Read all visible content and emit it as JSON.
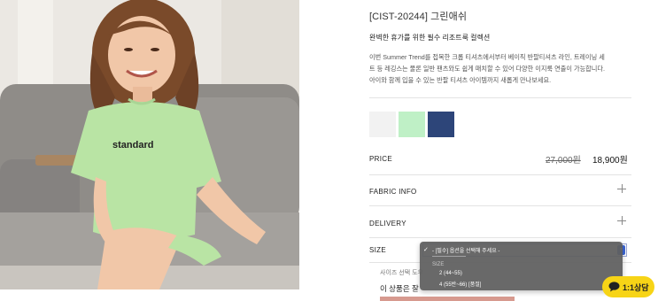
{
  "product": {
    "title": "[CIST-20244] 그린애쉬",
    "subtitle": "완벽한 휴가를 위한 필수 리조트룩 컬렉션",
    "description_lines": [
      "이번 Summer Trend를 접목한 크롭 티셔츠에서부터 베이직 반팔티셔츠 라인, 트레이닝 세",
      "트 등 레깅스는 물론 일반 팬츠와도 쉽게 매치할 수 있어 다양한 이지룩 연출이 가능합니다.",
      "아이와 함께 입을 수 있는 반팔 티셔츠 아이템까지 새롭게 만나보세요."
    ],
    "shirt_print": "standard"
  },
  "swatches": [
    {
      "name": "white",
      "color": "#f2f2f2"
    },
    {
      "name": "mint-green",
      "color": "#bff0c6"
    },
    {
      "name": "navy",
      "color": "#2d4579"
    }
  ],
  "price": {
    "label": "PRICE",
    "original": "27,000원",
    "sale": "18,900원"
  },
  "sections": {
    "fabric_info": "FABRIC INFO",
    "delivery": "DELIVERY"
  },
  "size": {
    "label": "SIZE",
    "dropdown": {
      "selected": "- [필수] 옵션을 선택해 주세요 -",
      "divider": "-------------------",
      "group_label": "SIZE",
      "options": [
        "2 (44~55)",
        "4 (55반~66) [품절]"
      ]
    }
  },
  "helper": {
    "line1": "사이즈 선택 도우",
    "line2": "이 상품은 잘 "
  },
  "chat": {
    "label": "1:1상담"
  },
  "colors": {
    "accent": "#3c66d6",
    "chat": "#f7d416",
    "buy_bar": "#d79a8f"
  }
}
